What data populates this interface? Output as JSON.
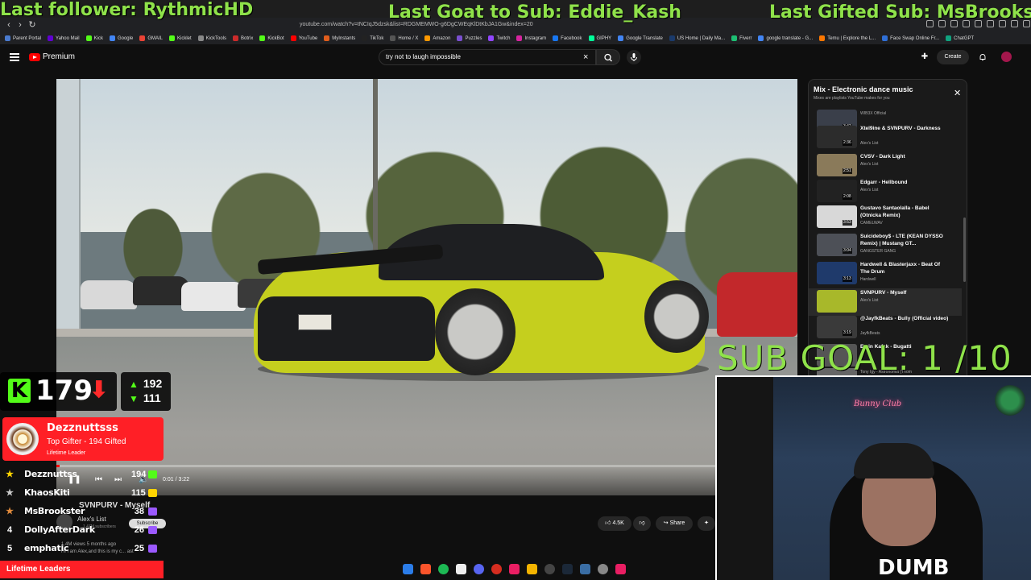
{
  "browser": {
    "url": "youtube.com/watch?v=tNCIqJ5dzsk&list=RDGMEMWO-g6DgCWEqKlDtKbJA1Gw&index=20",
    "bookmarks": [
      {
        "label": "Parent Portal",
        "color": "#4a7bd0"
      },
      {
        "label": "Yahoo Mail",
        "color": "#6001d2"
      },
      {
        "label": "Kick",
        "color": "#53fc18"
      },
      {
        "label": "Google",
        "color": "#4285f4"
      },
      {
        "label": "GMAIL",
        "color": "#ea4335"
      },
      {
        "label": "Kicklet",
        "color": "#53fc18"
      },
      {
        "label": "KickTools",
        "color": "#888888"
      },
      {
        "label": "Botrix",
        "color": "#cc2b2b"
      },
      {
        "label": "KickBot",
        "color": "#53fc18"
      },
      {
        "label": "YouTube",
        "color": "#ff0000"
      },
      {
        "label": "MyInstants",
        "color": "#e05d1c"
      },
      {
        "label": "TikTok",
        "color": "#222222"
      },
      {
        "label": "Home / X",
        "color": "#555555"
      },
      {
        "label": "Amazon",
        "color": "#ff9900"
      },
      {
        "label": "Puzzles",
        "color": "#7a4fd0"
      },
      {
        "label": "Twitch",
        "color": "#9146ff"
      },
      {
        "label": "Instagram",
        "color": "#d6249f"
      },
      {
        "label": "Facebook",
        "color": "#1877f2"
      },
      {
        "label": "GIPHY",
        "color": "#00ff99"
      },
      {
        "label": "Google Translate",
        "color": "#4285f4"
      },
      {
        "label": "US Home | Daily Ma...",
        "color": "#1a3a6b"
      },
      {
        "label": "Fiverr",
        "color": "#1dbf73"
      },
      {
        "label": "google translate - G...",
        "color": "#4285f4"
      },
      {
        "label": "Temu | Explore the L...",
        "color": "#fb7701"
      },
      {
        "label": "Face Swap Online Fr...",
        "color": "#2f6fd6"
      },
      {
        "label": "ChatGPT",
        "color": "#10a37f"
      }
    ]
  },
  "overlay": {
    "last_follower": "Last follower: RythmicHD",
    "last_goat": "Last Goat to Sub: Eddie_Kash",
    "last_gifted": "Last Gifted Sub: MsBrookster",
    "sub_goal": "SUB GOAL: 1  /10"
  },
  "youtube": {
    "premium_label": "Premium",
    "search_value": "try not to laugh impossible",
    "create_label": "Create",
    "video": {
      "time": "0:01 / 3:22",
      "progress_fraction": 0.005,
      "title": "SVNPURV - Myself",
      "channel": "Alex's List",
      "subscribers": "1.47M subscribers",
      "subscribe_label": "Subscribe",
      "likes": "4.5K",
      "share_label": "Share",
      "views_line": "1.4M views  5 months ago",
      "desc_line": "Hi I am Alex,and this is my c... ast"
    },
    "playlist": {
      "title": "Mix - Electronic dance music",
      "subtitle": "Mixes are playlists YouTube makes for you",
      "items": [
        {
          "name": "",
          "artist": "WIB3X Official",
          "duration": "3:42",
          "color": "#3a3f4a"
        },
        {
          "name": "Xtel9ine & SVNPURV - Darkness",
          "artist": "Alex's List",
          "duration": "2:36",
          "color": "#2c2c2c"
        },
        {
          "name": "CVSV - Dark Light",
          "artist": "Alex's List",
          "duration": "2:51",
          "color": "#8a7a5a"
        },
        {
          "name": "Edgarr - Hellbound",
          "artist": "Alex's List",
          "duration": "2:08",
          "color": "#222222"
        },
        {
          "name": "Gustavo Santaolalla - Babel (Otnicka Remix)",
          "artist": "CAMELWAV",
          "duration": "3:53",
          "color": "#d8d8d8"
        },
        {
          "name": "Suicideboy$ - LTE (KEAN DYSSO Remix) | Mustang GT...",
          "artist": "GANGSTER GANG",
          "duration": "3:04",
          "color": "#4d5057"
        },
        {
          "name": "Hardwell & Blasterjaxx - Beat Of The Drum",
          "artist": "Hardwell",
          "duration": "3:13",
          "color": "#1f3a6b"
        },
        {
          "name": "SVNPURV - Myself",
          "artist": "Alex's List",
          "duration": "",
          "color": "#a8b82a"
        },
        {
          "name": "@JayfkBeats - Bully (Official video)",
          "artist": "JayfkBeats",
          "duration": "3:19",
          "color": "#3a3a3a"
        },
        {
          "name": "Emin Kafak - Bugatti",
          "artist": "",
          "duration": "",
          "color": "#555555"
        },
        {
          "name": "",
          "artist": "Tony Igy - Astronomia (Thom",
          "duration": "",
          "color": "#666666"
        }
      ]
    }
  },
  "kick": {
    "count": "179",
    "up": "192",
    "down": "111",
    "top_gifter_name": "Dezznuttsss",
    "top_gifter_sub": "Top Gifter - 194 Gifted",
    "top_gifter_tag": "Lifetime Leader",
    "leaderboard": [
      {
        "rank": "",
        "name": "Dezznuttss",
        "count": "194",
        "gift_color": "#53fc18"
      },
      {
        "rank": "",
        "name": "KhaosKiti",
        "count": "115",
        "gift_color": "#ffd400"
      },
      {
        "rank": "",
        "name": "MsBrookster",
        "count": "38",
        "gift_color": "#9b59ff"
      },
      {
        "rank": "4",
        "name": "DollyAfterDark",
        "count": "26",
        "gift_color": "#9b59ff"
      },
      {
        "rank": "5",
        "name": "emphatic",
        "count": "25",
        "gift_color": "#9b59ff"
      }
    ],
    "footer": "Lifetime Leaders"
  },
  "webcam": {
    "neon_sign": "Bunny Club",
    "shirt_text": "DUMB"
  }
}
